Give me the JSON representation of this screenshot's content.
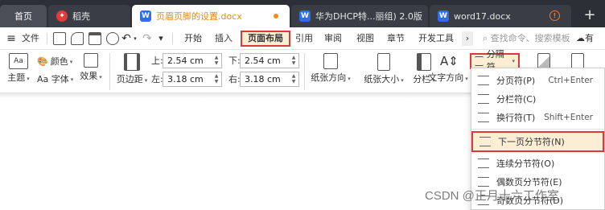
{
  "tabs": {
    "home": "首页",
    "daoke": "稻壳",
    "active": "页眉页脚的设置.docx",
    "third": "华为DHCP特...丽组) 2.0版",
    "fourth": "word17.docx",
    "plus": "+"
  },
  "menu": {
    "hamburger": "≡",
    "file": "文件",
    "items": [
      "开始",
      "插入",
      "页面布局",
      "引用",
      "审阅",
      "视图",
      "章节",
      "开发工具"
    ],
    "more": "›",
    "search_placeholder": "查找命令、搜索模板",
    "cloud_label": "有"
  },
  "ribbon": {
    "theme": "主题",
    "color": "颜色",
    "font": "Aa 字体",
    "effect": "效果",
    "margins": "页边距",
    "top_label": "上:",
    "top_value": "2.54 cm",
    "bottom_label": "下:",
    "bottom_value": "2.54 cm",
    "left_label": "左:",
    "left_value": "3.18 cm",
    "right_label": "右:",
    "right_value": "3.18 cm",
    "orientation": "纸张方向",
    "size": "纸张大小",
    "columns": "分栏",
    "text_direction": "文字方向",
    "breaks": "分隔符"
  },
  "breaks_menu": {
    "items": [
      {
        "label": "分页符(P)",
        "shortcut": "Ctrl+Enter"
      },
      {
        "label": "分栏符(C)",
        "shortcut": ""
      },
      {
        "label": "换行符(T)",
        "shortcut": "Shift+Enter"
      },
      {
        "label": "下一页分节符(N)",
        "shortcut": ""
      },
      {
        "label": "连续分节符(O)",
        "shortcut": ""
      },
      {
        "label": "偶数页分节符(E)",
        "shortcut": ""
      },
      {
        "label": "奇数页分节符(D)",
        "shortcut": ""
      }
    ]
  },
  "watermark": "CSDN @正月十六工作室",
  "colors": {
    "tabbar": "#2c2f36",
    "highlight_border": "#d93a3a",
    "highlight_fill": "#fbeed4",
    "active_doc_icon": "#2f6fe6",
    "daoke_icon": "#e03c3c"
  }
}
